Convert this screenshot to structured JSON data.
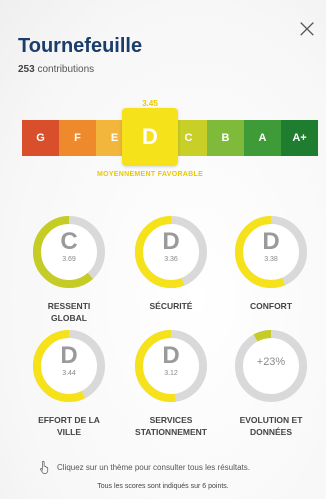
{
  "header": {
    "title": "Tournefeuille",
    "contrib_count": "253",
    "contrib_label": "contributions",
    "close_icon": "close-icon"
  },
  "scale": {
    "score": "3.45",
    "caption": "MOYENNEMENT FAVORABLE",
    "active_letter": "D",
    "grades": [
      {
        "letter": "G",
        "color": "#d94f2b"
      },
      {
        "letter": "F",
        "color": "#ef8a2c"
      },
      {
        "letter": "E",
        "color": "#f3b63c"
      },
      {
        "letter": "D",
        "color": "#f5e21b"
      },
      {
        "letter": "C",
        "color": "#c8cf27"
      },
      {
        "letter": "B",
        "color": "#7fba3a"
      },
      {
        "letter": "A",
        "color": "#3f9b37"
      },
      {
        "letter": "A+",
        "color": "#1f7d2f"
      }
    ]
  },
  "themes": [
    {
      "letter": "C",
      "value": "3.69",
      "label1": "RESSENTI",
      "label2": "GLOBAL",
      "fraction": 0.615,
      "color": "#c5cc25"
    },
    {
      "letter": "D",
      "value": "3.36",
      "label1": "SÉCURITÉ",
      "label2": "",
      "fraction": 0.56,
      "color": "#f5e21b"
    },
    {
      "letter": "D",
      "value": "3.38",
      "label1": "CONFORT",
      "label2": "",
      "fraction": 0.563,
      "color": "#f5e21b"
    },
    {
      "letter": "D",
      "value": "3.44",
      "label1": "EFFORT DE LA",
      "label2": "VILLE",
      "fraction": 0.573,
      "color": "#f5e21b"
    },
    {
      "letter": "D",
      "value": "3.12",
      "label1": "SERVICES",
      "label2": "STATIONNEMENT",
      "fraction": 0.52,
      "color": "#f5e21b"
    },
    {
      "letter": "",
      "value": "+23%",
      "label1": "EVOLUTION ET",
      "label2": "DONNÉES",
      "fraction": 0.08,
      "color": "#c5cc25",
      "is_percent": true
    }
  ],
  "hint": {
    "text": "Cliquez sur un thème pour consulter tous les résultats.",
    "icon": "hand-pointer-icon"
  },
  "footnote": "Tous les scores sont indiqués sur 6 points."
}
